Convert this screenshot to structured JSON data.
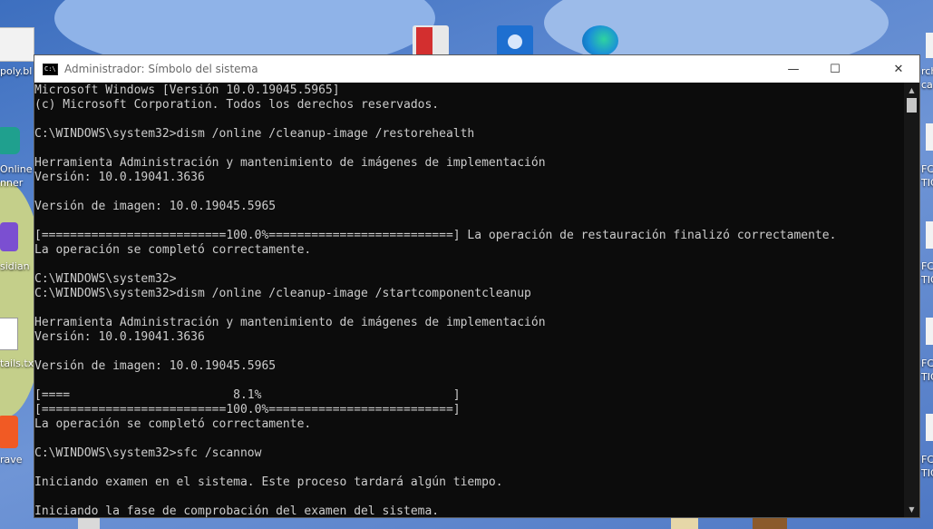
{
  "desktop": {
    "left_labels": [
      "poly.bl",
      "Online",
      "nner",
      "sidian",
      "tails.txt",
      "rave"
    ],
    "right_labels": [
      "rch",
      "ca",
      "FC",
      "TIC",
      "FC",
      "TIC",
      "FC",
      "TIC",
      "FC",
      "TIC"
    ]
  },
  "window": {
    "app_icon_text": "C:\\",
    "title": "Administrador: Símbolo del sistema",
    "minimize_glyph": "—",
    "maximize_glyph": "☐",
    "close_glyph": "✕"
  },
  "console": {
    "lines": [
      "Microsoft Windows [Versión 10.0.19045.5965]",
      "(c) Microsoft Corporation. Todos los derechos reservados.",
      "",
      "C:\\WINDOWS\\system32>dism /online /cleanup-image /restorehealth",
      "",
      "Herramienta Administración y mantenimiento de imágenes de implementación",
      "Versión: 10.0.19041.3636",
      "",
      "Versión de imagen: 10.0.19045.5965",
      "",
      "[==========================100.0%==========================] La operación de restauración finalizó correctamente.",
      "La operación se completó correctamente.",
      "",
      "C:\\WINDOWS\\system32>",
      "C:\\WINDOWS\\system32>dism /online /cleanup-image /startcomponentcleanup",
      "",
      "Herramienta Administración y mantenimiento de imágenes de implementación",
      "Versión: 10.0.19041.3636",
      "",
      "Versión de imagen: 10.0.19045.5965",
      "",
      "[====                       8.1%                           ]",
      "[==========================100.0%==========================]",
      "La operación se completó correctamente.",
      "",
      "C:\\WINDOWS\\system32>sfc /scannow",
      "",
      "Iniciando examen en el sistema. Este proceso tardará algún tiempo.",
      "",
      "Iniciando la fase de comprobación del examen del sistema."
    ]
  },
  "scrollbar": {
    "up_glyph": "▲",
    "down_glyph": "▼"
  }
}
